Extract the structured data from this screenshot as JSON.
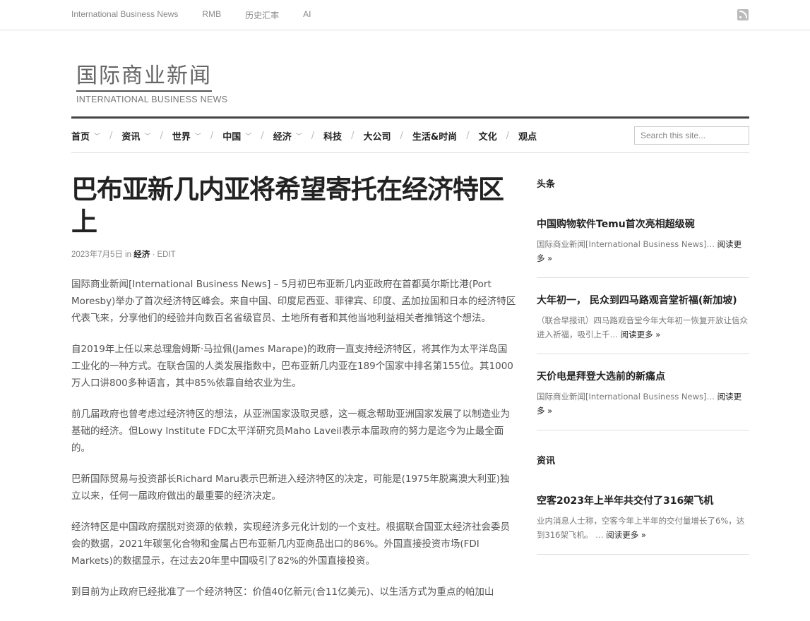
{
  "topbar": {
    "links": [
      "International Business News",
      "RMB",
      "历史汇率",
      "AI"
    ]
  },
  "logo": {
    "cn": "国际商业新闻",
    "en": "INTERNATIONAL BUSINESS NEWS"
  },
  "nav": {
    "items": [
      {
        "label": "首页",
        "dropdown": true
      },
      {
        "label": "资讯",
        "dropdown": true
      },
      {
        "label": "世界",
        "dropdown": true
      },
      {
        "label": "中国",
        "dropdown": true
      },
      {
        "label": "经济",
        "dropdown": true
      },
      {
        "label": "科技",
        "dropdown": false
      },
      {
        "label": "大公司",
        "dropdown": false
      },
      {
        "label": "生活&时尚",
        "dropdown": false
      },
      {
        "label": "文化",
        "dropdown": false
      },
      {
        "label": "观点",
        "dropdown": false
      }
    ],
    "search_placeholder": "Search this site..."
  },
  "article": {
    "title": "巴布亚新几内亚将希望寄托在经济特区上",
    "date": "2023年7月5日",
    "in": "in",
    "category": "经济",
    "edit": "EDIT",
    "paragraphs": [
      "国际商业新闻[International Business News] – 5月初巴布亚新几内亚政府在首都莫尔斯比港(Port Moresby)举办了首次经济特区峰会。来自中国、印度尼西亚、菲律宾、印度、孟加拉国和日本的经济特区代表飞来，分享他们的经验并向数百名省级官员、土地所有者和其他当地利益相关者推销这个想法。",
      "自2019年上任以来总理詹姆斯·马拉佩(James Marape)的政府一直支持经济特区，将其作为太平洋岛国工业化的一种方式。在联合国的人类发展指数中，巴布亚新几内亚在189个国家中排名第155位。其1000万人口讲800多种语言，其中85%依靠自给农业为生。",
      "前几届政府也曾考虑过经济特区的想法，从亚洲国家汲取灵感，这一概念帮助亚洲国家发展了以制造业为基础的经济。但Lowy Institute FDC太平洋研究员Maho Laveil表示本届政府的努力是迄今为止最全面的。",
      "巴新国际贸易与投资部长Richard Maru表示巴新进入经济特区的决定，可能是(1975年脱离澳大利亚)独立以来，任何一届政府做出的最重要的经济决定。",
      "经济特区是中国政府摆脱对资源的依赖，实现经济多元化计划的一个支柱。根据联合国亚太经济社会委员会的数据，2021年碳氢化合物和金属占巴布亚新几内亚商品出口的86%。外国直接投资市场(FDI Markets)的数据显示，在过去20年里中国吸引了82%的外国直接投资。",
      "到目前为止政府已经批准了一个经济特区：价值40亿新元(合11亿美元)、以生活方式为重点的帕加山"
    ]
  },
  "sidebar": {
    "headlines_title": "头条",
    "headlines": [
      {
        "title": "中国购物软件Temu首次亮相超级碗",
        "excerpt": "国际商业新闻[International Business News]…",
        "more": "阅读更多 »"
      },
      {
        "title": "大年初一， 民众到四马路观音堂祈福(新加坡)",
        "excerpt": "（联合早报讯）四马路观音堂今年大年初一恢复开放让信众进入祈福，吸引上千…",
        "more": "阅读更多 »"
      },
      {
        "title": "天价电是拜登大选前的新痛点",
        "excerpt": "国际商业新闻[International Business News]…",
        "more": "阅读更多 »"
      }
    ],
    "news_title": "资讯",
    "news": [
      {
        "title": "空客2023年上半年共交付了316架飞机",
        "excerpt": "业内消息人士称，空客今年上半年的交付量增长了6%，达到316架飞机。 …",
        "more": "阅读更多 »"
      }
    ]
  }
}
